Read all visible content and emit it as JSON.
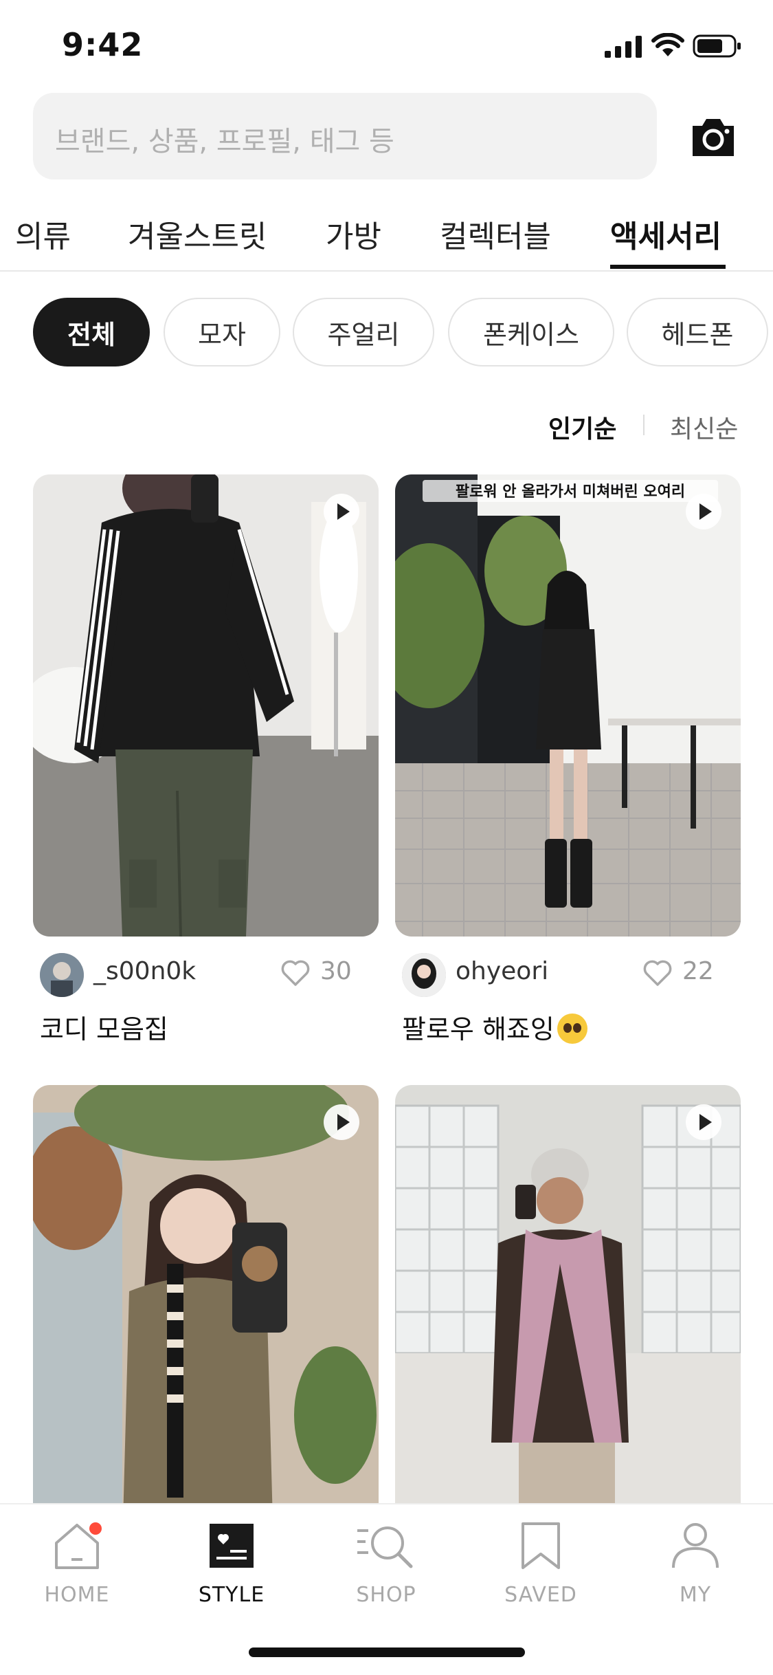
{
  "status_bar": {
    "time": "9:42"
  },
  "search": {
    "placeholder": "브랜드, 상품, 프로필, 태그 등"
  },
  "category_tabs": [
    {
      "label": "의류",
      "active": false
    },
    {
      "label": "겨울스트릿",
      "active": false
    },
    {
      "label": "가방",
      "active": false
    },
    {
      "label": "컬렉터블",
      "active": false
    },
    {
      "label": "액세서리",
      "active": true
    }
  ],
  "filter_chips": [
    {
      "label": "전체",
      "active": true
    },
    {
      "label": "모자",
      "active": false
    },
    {
      "label": "주얼리",
      "active": false
    },
    {
      "label": "폰케이스",
      "active": false
    },
    {
      "label": "헤드폰",
      "active": false
    }
  ],
  "sort": {
    "popular": "인기순",
    "latest": "최신순",
    "selected": "인기순"
  },
  "feed": [
    {
      "username": "_s00n0k",
      "likes": "30",
      "title": "코디 모음집",
      "has_video": true
    },
    {
      "username": "ohyeori",
      "likes": "22",
      "title": "팔로우 해죠잉",
      "title_emoji": "pleading-face",
      "overlay_caption": "팔로워 안 올라가서 미쳐버린 오여리",
      "has_video": true
    },
    {
      "username": "",
      "likes": "",
      "title": "",
      "has_video": true
    },
    {
      "username": "",
      "likes": "",
      "title": "",
      "has_video": true
    }
  ],
  "bottom_nav": [
    {
      "label": "HOME",
      "icon": "home-icon",
      "badge": true
    },
    {
      "label": "STYLE",
      "icon": "style-icon",
      "active": true
    },
    {
      "label": "SHOP",
      "icon": "shop-search-icon"
    },
    {
      "label": "SAVED",
      "icon": "bookmark-icon"
    },
    {
      "label": "MY",
      "icon": "profile-icon"
    }
  ],
  "colors": {
    "accent": "#111111",
    "badge": "#ff4b3a",
    "inactive": "#a8a8a8",
    "chip_active_bg": "#1a1a1a"
  }
}
